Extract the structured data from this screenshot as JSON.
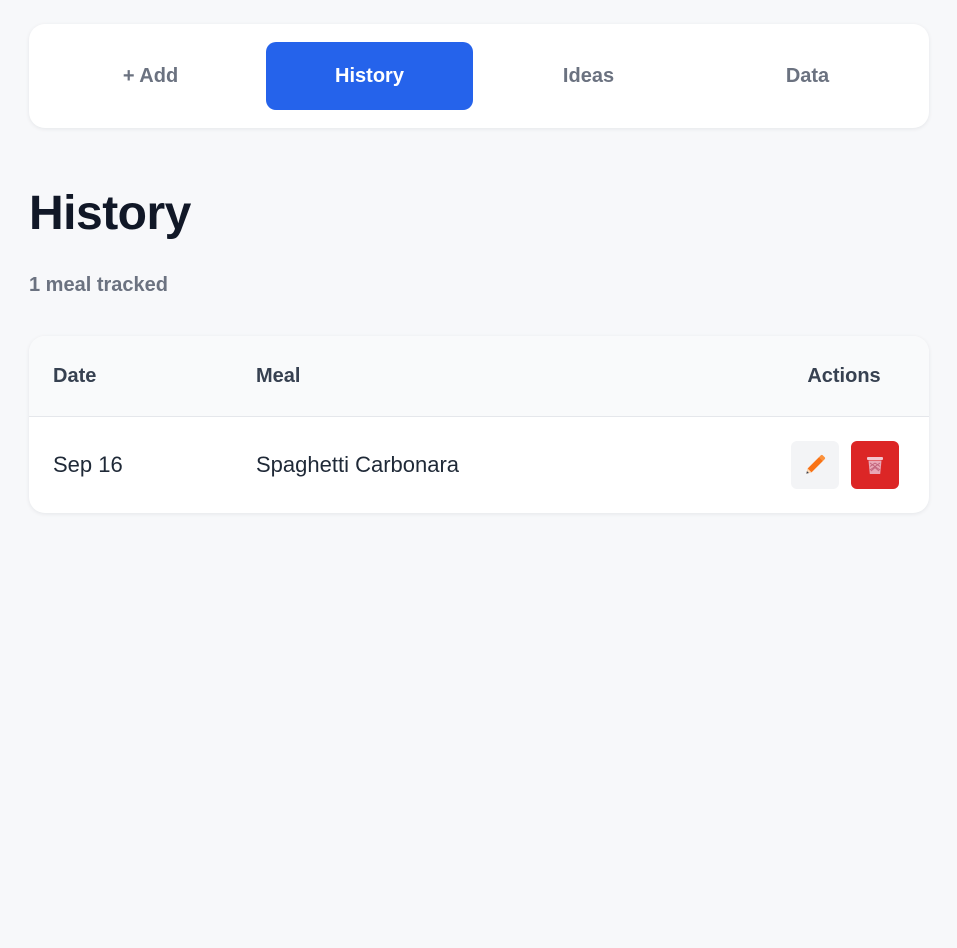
{
  "nav": {
    "tabs": [
      {
        "label": "+ Add",
        "active": false
      },
      {
        "label": "History",
        "active": true
      },
      {
        "label": "Ideas",
        "active": false
      },
      {
        "label": "Data",
        "active": false
      }
    ]
  },
  "page": {
    "title": "History",
    "subtitle": "1 meal tracked"
  },
  "table": {
    "headers": {
      "date": "Date",
      "meal": "Meal",
      "actions": "Actions"
    },
    "rows": [
      {
        "date": "Sep 16",
        "meal": "Spaghetti Carbonara"
      }
    ]
  },
  "icons": {
    "edit": "pencil-icon",
    "delete": "trash-icon"
  },
  "colors": {
    "accent": "#2563eb",
    "danger": "#dc2626",
    "background": "#f7f8fa",
    "pencil": "#f97316"
  }
}
